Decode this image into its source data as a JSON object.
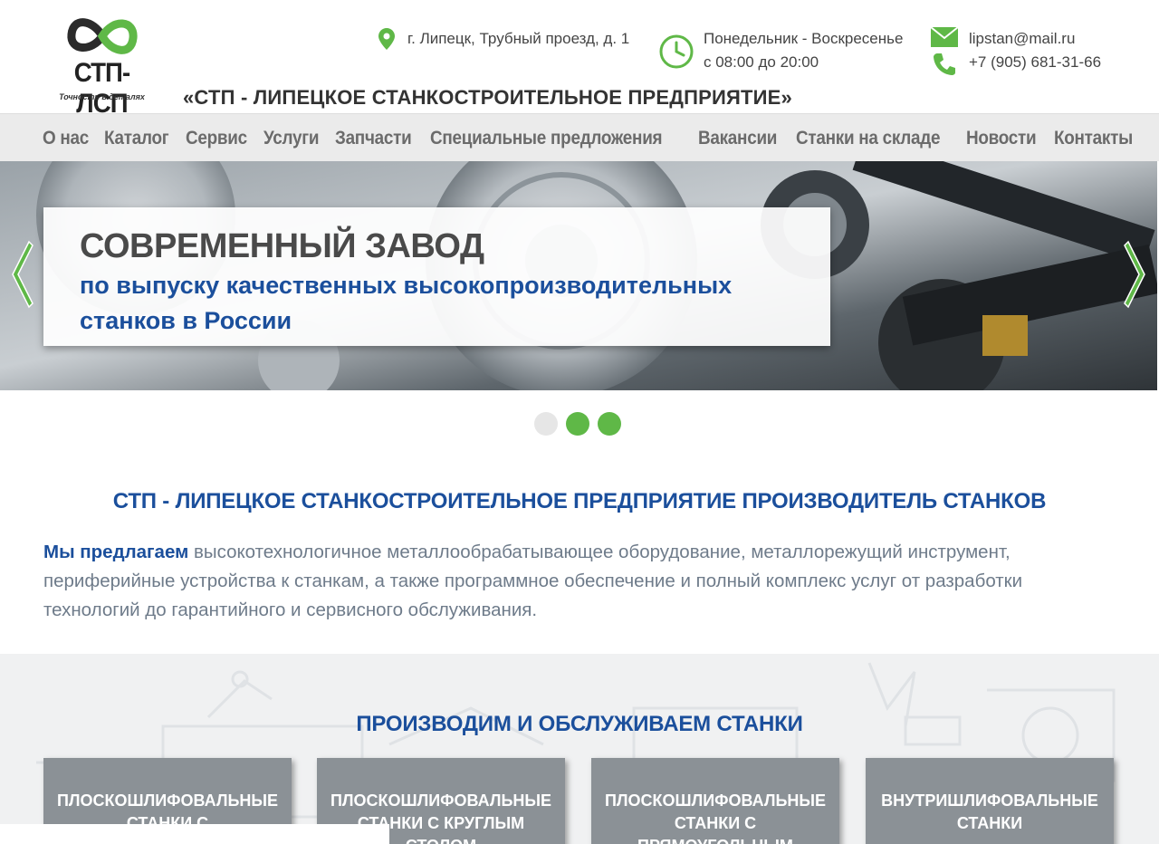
{
  "header": {
    "logo_text": "СТП-ЛСП",
    "logo_slogan": "Точность в деталях",
    "address": "г. Липецк, Трубный проезд, д. 1",
    "hours_days": "Понедельник - Воскресенье",
    "hours_time": "с 08:00 до 20:00",
    "email": "lipstan@mail.ru",
    "phone": "+7 (905) 681-31-66",
    "company_title": "«СТП - ЛИПЕЦКОЕ СТАНКОСТРОИТЕЛЬНОЕ ПРЕДПРИЯТИЕ»"
  },
  "nav": {
    "items": [
      {
        "label": "О нас"
      },
      {
        "label": "Каталог"
      },
      {
        "label": "Сервис"
      },
      {
        "label": "Услуги"
      },
      {
        "label": "Запчасти"
      },
      {
        "label": "Специальные предложения"
      },
      {
        "label": "Вакансии"
      },
      {
        "label": "Станки на складе"
      },
      {
        "label": "Новости"
      },
      {
        "label": "Контакты"
      }
    ]
  },
  "slider": {
    "title": "СОВРЕМЕННЫЙ ЗАВОД",
    "subtitle": "по выпуску качественных высокопроизводительных станков в России",
    "active_slide": 2,
    "slide_count": 3
  },
  "about": {
    "title": "СТП - ЛИПЕЦКОЕ СТАНКОСТРОИТЕЛЬНОЕ ПРЕДПРИЯТИЕ ПРОИЗВОДИТЕЛЬ СТАНКОВ",
    "lead": "Мы предлагаем",
    "text": " высокотехнологичное металлообрабатывающее оборудование, металлорежущий инструмент, периферийные устройства к станкам, а также программное обеспечение и полный комплекс услуг от разработки технологий до гарантийного и сервисного обслуживания."
  },
  "products": {
    "title": "ПРОИЗВОДИМ И ОБСЛУЖИВАЕМ СТАНКИ",
    "cards": [
      {
        "label": "ПЛОСКОШЛИФОВАЛЬНЫЕ СТАНКИ С ПРЯМОУГОЛЬНЫМ СТОЛОМ"
      },
      {
        "label": "ПЛОСКОШЛИФОВАЛЬНЫЕ СТАНКИ С КРУГЛЫМ СТОЛОМ"
      },
      {
        "label": "ПЛОСКОШЛИФОВАЛЬНЫЕ СТАНКИ С ПРЯМОУГОЛЬНЫМ КРЕСТОВЫМ СТОЛОМ"
      },
      {
        "label": "ВНУТРИШЛИФОВАЛЬНЫЕ СТАНКИ"
      }
    ]
  },
  "colors": {
    "brand_green": "#5fb847",
    "brand_blue": "#1b4f9c",
    "nav_bg": "#ebebeb",
    "card_bg": "#8b9196"
  }
}
